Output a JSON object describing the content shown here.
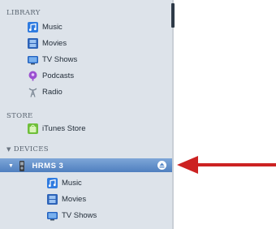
{
  "sidebar": {
    "library": {
      "heading": "LIBRARY",
      "items": [
        {
          "label": "Music",
          "icon": "music-note-icon"
        },
        {
          "label": "Movies",
          "icon": "film-icon"
        },
        {
          "label": "TV Shows",
          "icon": "tv-icon"
        },
        {
          "label": "Podcasts",
          "icon": "podcast-icon"
        },
        {
          "label": "Radio",
          "icon": "radio-antenna-icon"
        }
      ]
    },
    "store": {
      "heading": "STORE",
      "items": [
        {
          "label": "iTunes Store",
          "icon": "itunes-store-icon"
        }
      ]
    },
    "devices": {
      "heading": "DEVICES",
      "device": {
        "label": "HRMS 3",
        "icon": "ipod-icon",
        "eject_icon": "eject-icon",
        "selected": true
      },
      "items": [
        {
          "label": "Music",
          "icon": "music-note-icon"
        },
        {
          "label": "Movies",
          "icon": "film-icon"
        },
        {
          "label": "TV Shows",
          "icon": "tv-icon"
        }
      ]
    }
  },
  "annotation": {
    "arrow_color": "#cc2222",
    "icon": "red-arrow-icon"
  },
  "colors": {
    "sidebar_bg": "#dde3ea",
    "selection": "#5c8bc8"
  }
}
